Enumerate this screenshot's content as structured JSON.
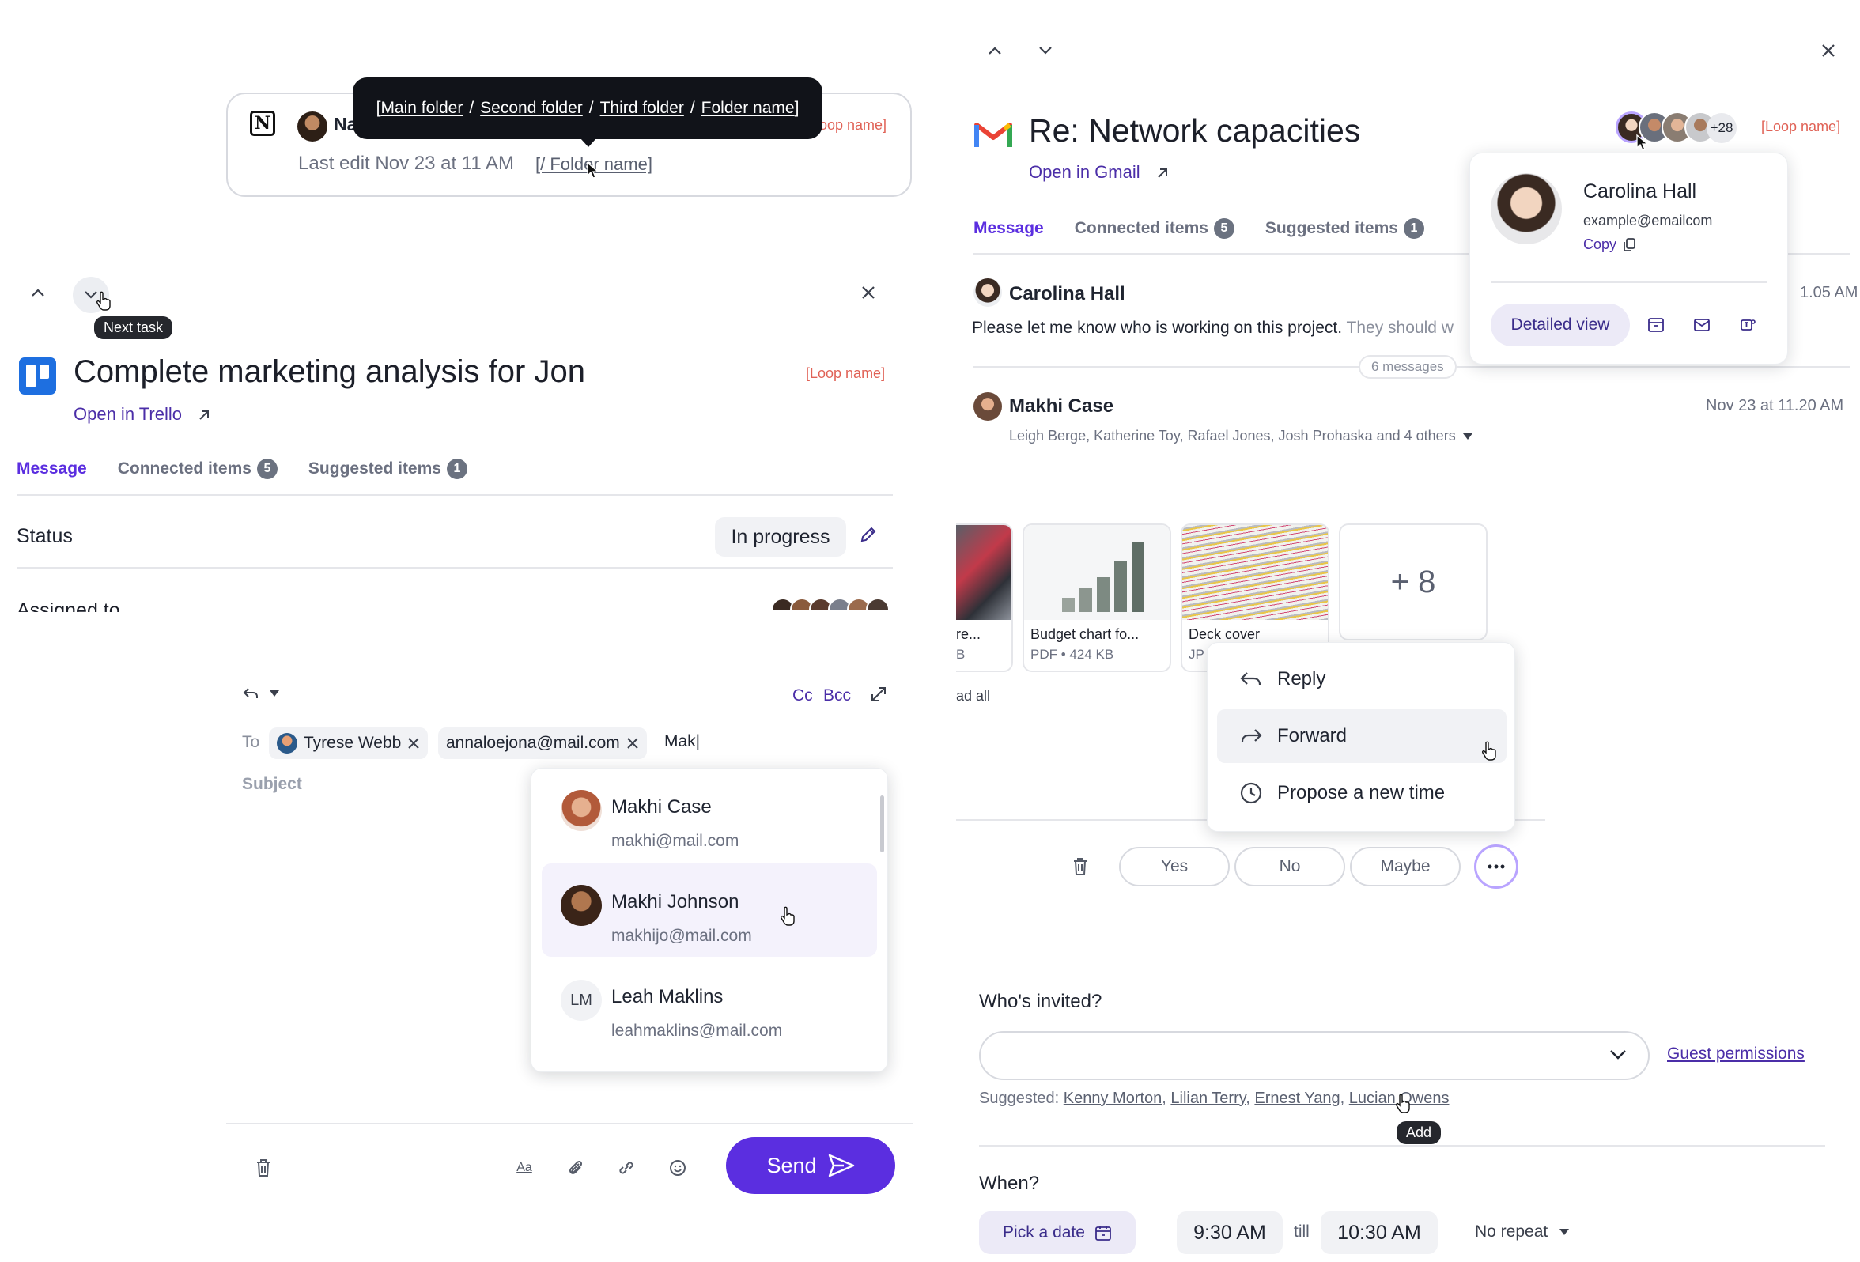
{
  "notion_card": {
    "name_short": "Na",
    "last_edit": "Last edit Nov 23 at 11 AM",
    "folder_link": "[/ Folder name]",
    "loop": "oop name]",
    "tooltip": {
      "open": "[",
      "segments": [
        "Main folder",
        "Second folder",
        "Third folder",
        "Folder name"
      ],
      "separator": "/",
      "close": "]"
    }
  },
  "task": {
    "next_tooltip": "Next task",
    "title": "Complete marketing analysis for Jon",
    "loop": "[Loop name]",
    "open_link": "Open in Trello",
    "tabs": {
      "message": "Message",
      "connected": "Connected items",
      "connected_count": "5",
      "suggested": "Suggested items",
      "suggested_count": "1"
    },
    "status_label": "Status",
    "status_value": "In progress",
    "assigned_label": "Assigned to"
  },
  "compose": {
    "to_label": "To",
    "recipients": [
      "Tyrese Webb",
      "annaloejona@mail.com"
    ],
    "typed": "Mak|",
    "cc": "Cc",
    "bcc": "Bcc",
    "subject_placeholder": "Subject",
    "suggestions": [
      {
        "name": "Makhi Case",
        "email": "makhi@mail.com"
      },
      {
        "name": "Makhi Johnson",
        "email": "makhijo@mail.com"
      },
      {
        "name": "Leah Maklins",
        "email": "leahmaklins@mail.com",
        "initials": "LM"
      }
    ],
    "format_icon_text": "Aa",
    "send": "Send"
  },
  "gmail": {
    "title": "Re: Network capacities",
    "open_link": "Open in Gmail",
    "loop": "[Loop name]",
    "more_avatars": "+28",
    "tabs": {
      "message": "Message",
      "connected": "Connected items",
      "connected_count": "5",
      "suggested": "Suggested items",
      "suggested_count": "1"
    },
    "contact": {
      "name": "Carolina Hall",
      "email": "example@emailcom",
      "copy": "Copy",
      "detailed": "Detailed view"
    },
    "message1": {
      "sender": "Carolina Hall",
      "text": "Please let me know who is working on this project.",
      "text_faded": "They should w",
      "time": "1.05 AM"
    },
    "message_count": "6 messages",
    "message2": {
      "sender": "Makhi Case",
      "time": "Nov 23 at 11.20 AM",
      "recipients": "Leigh Berge, Katherine Toy, Rafael Jones, Josh Prohaska and 4 others"
    },
    "attachments": [
      {
        "name": "re...",
        "meta": "B"
      },
      {
        "name": "Budget chart fo...",
        "meta": "PDF • 424 KB"
      },
      {
        "name": "Deck cover",
        "meta": "JP"
      }
    ],
    "attachments_more": "+ 8",
    "download_all": "ad all",
    "menu": [
      "Reply",
      "Forward",
      "Propose a new time"
    ],
    "rsvp": [
      "Yes",
      "No",
      "Maybe"
    ],
    "invited_label": "Who's invited?",
    "guest_permissions": "Guest permissions",
    "suggested_prefix": "Suggested:",
    "suggested_people": [
      "Kenny Morton",
      "Lilian Terry",
      "Ernest Yang",
      "Lucian Owens"
    ],
    "add_tip": "Add",
    "when_label": "When?",
    "pick_date": "Pick a date",
    "start_time": "9:30 AM",
    "till": "till",
    "end_time": "10:30 AM",
    "repeat": "No repeat"
  },
  "colors": {
    "accent": "#5b2ee0",
    "link": "#4b2ea8",
    "loop": "#e06256",
    "trello": "#1e6fe0"
  }
}
